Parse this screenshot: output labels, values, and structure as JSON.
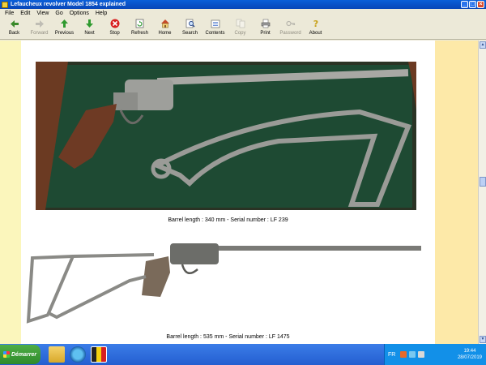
{
  "window": {
    "title": "Lefaucheux revolver Model 1854 explained"
  },
  "menu": [
    "File",
    "Edit",
    "View",
    "Go",
    "Options",
    "Help"
  ],
  "toolbar": [
    {
      "label": "Back",
      "icon": "back-arrow-icon",
      "enabled": true
    },
    {
      "label": "Forward",
      "icon": "forward-arrow-icon",
      "enabled": false
    },
    {
      "label": "Previous",
      "icon": "up-arrow-icon",
      "enabled": true
    },
    {
      "label": "Next",
      "icon": "down-arrow-icon",
      "enabled": true
    },
    {
      "label": "Stop",
      "icon": "stop-icon",
      "enabled": true
    },
    {
      "label": "Refresh",
      "icon": "refresh-icon",
      "enabled": true
    },
    {
      "label": "Home",
      "icon": "home-icon",
      "enabled": true
    },
    {
      "label": "Search",
      "icon": "search-icon",
      "enabled": true
    },
    {
      "label": "Contents",
      "icon": "contents-icon",
      "enabled": true
    },
    {
      "label": "Copy",
      "icon": "copy-icon",
      "enabled": false
    },
    {
      "label": "Print",
      "icon": "print-icon",
      "enabled": true
    },
    {
      "label": "Password",
      "icon": "key-icon",
      "enabled": false
    },
    {
      "label": "About",
      "icon": "about-icon",
      "enabled": true
    }
  ],
  "document": {
    "captions": [
      "Barrel length : 340 mm - Serial number : LF 239",
      "Barrel length : 535 mm - Serial number : LF 1475"
    ]
  },
  "taskbar": {
    "start_label": "Démarrer",
    "language": "FR",
    "time": "19:44",
    "date": "28/07/2019"
  },
  "colors": {
    "page_background": "#fbf6bc",
    "right_margin": "#fde9a8",
    "case_felt": "#1f4a32",
    "taskbar": "#245ed0"
  }
}
